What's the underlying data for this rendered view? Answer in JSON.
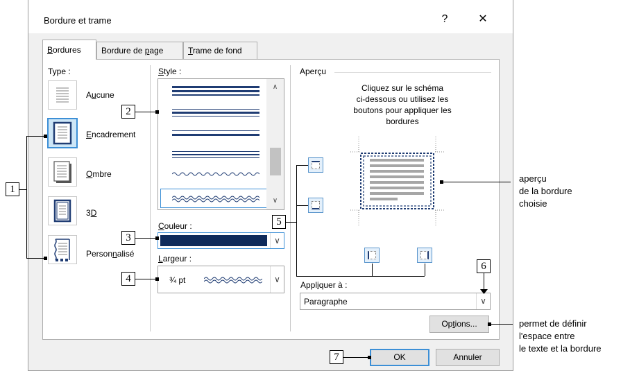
{
  "dialog": {
    "title": "Bordure et trame",
    "help_label": "?",
    "close_label": "✕"
  },
  "tabs": [
    {
      "label_u": "B",
      "label_rest": "ordures"
    },
    {
      "label_pre": "Bordure de ",
      "label_u": "p",
      "label_rest": "age"
    },
    {
      "label_u": "T",
      "label_rest": "rame de fond"
    }
  ],
  "type_section": {
    "label": "Type :",
    "items": [
      {
        "pre": "A",
        "u": "u",
        "post": "cune"
      },
      {
        "pre": "",
        "u": "E",
        "post": "ncadrement"
      },
      {
        "pre": "",
        "u": "O",
        "post": "mbre"
      },
      {
        "pre": "3",
        "u": "D",
        "post": ""
      },
      {
        "pre": "Person",
        "u": "n",
        "post": "alisé"
      }
    ]
  },
  "style_section": {
    "label_u": "S",
    "label_rest": "tyle :"
  },
  "color_section": {
    "label_u": "C",
    "label_rest": "ouleur :",
    "value_color": "#0f2b5b"
  },
  "width_section": {
    "label_u": "L",
    "label_rest": "argeur :",
    "value": "¾ pt"
  },
  "preview": {
    "label": "Aperçu",
    "instruction_lines": [
      "Cliquez sur le schéma",
      "ci-dessous ou utilisez les",
      "boutons pour appliquer les",
      "bordures"
    ]
  },
  "apply_to": {
    "label_pre": "Appl",
    "label_u": "i",
    "label_rest": "quer à :",
    "value": "Paragraphe"
  },
  "buttons": {
    "options_pre": "Op",
    "options_u": "t",
    "options_rest": "ions...",
    "ok": "OK",
    "cancel": "Annuler"
  },
  "callouts": [
    "1",
    "2",
    "3",
    "4",
    "5",
    "6",
    "7"
  ],
  "annotations": {
    "preview_lines": [
      "aperçu",
      "de la bordure",
      "choisie"
    ],
    "options_lines": [
      "permet de définir",
      "l'espace entre",
      "le texte et la bordure"
    ]
  },
  "colors": {
    "accent": "#3c8fd6",
    "border_color": "#0f2b5b",
    "selection": "#cde6f7"
  }
}
